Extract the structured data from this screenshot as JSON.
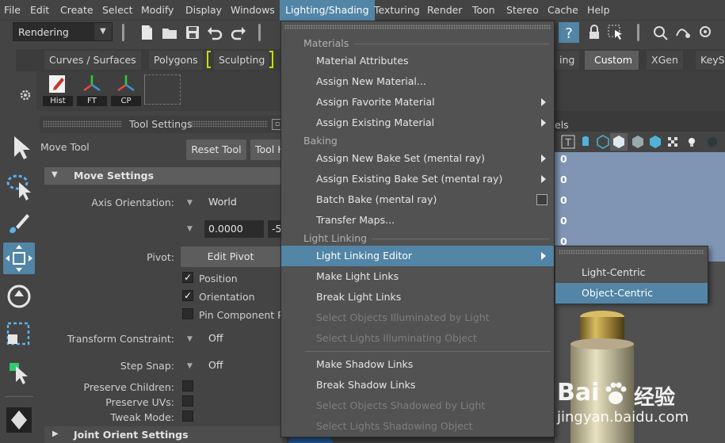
{
  "menubar": {
    "items": [
      "File",
      "Edit",
      "Create",
      "Select",
      "Modify",
      "Display",
      "Windows",
      "Lighting/Shading",
      "Texturing",
      "Render",
      "Toon",
      "Stereo",
      "Cache",
      "Help"
    ],
    "active": "Lighting/Shading"
  },
  "status": {
    "mode_value": "Rendering"
  },
  "shelf": {
    "tabs": [
      "Curves / Surfaces",
      "Polygons",
      "Sculpting",
      "ing",
      "Custom",
      "XGen",
      "KeySh"
    ],
    "active_tab": "Custom",
    "buttons": [
      "Hist",
      "FT",
      "CP"
    ]
  },
  "tool_settings": {
    "header": "Tool Settings",
    "tool_name": "Move Tool",
    "reset_button": "Reset Tool",
    "help_button": "Tool H",
    "section_move": "Move Settings",
    "axis_orientation_label": "Axis Orientation:",
    "axis_orientation_value": "World",
    "num_field_1": "0.0000",
    "num_field_2": "-5",
    "pivot_label": "Pivot:",
    "edit_pivot_button": "Edit Pivot",
    "position_label": "Position",
    "orientation_label": "Orientation",
    "pin_component_label": "Pin Component Pi",
    "transform_constraint_label": "Transform Constraint:",
    "transform_constraint_value": "Off",
    "step_snap_label": "Step Snap:",
    "step_snap_value": "Off",
    "preserve_children_label": "Preserve Children:",
    "preserve_uvs_label": "Preserve UVs:",
    "tweak_mode_label": "Tweak Mode:",
    "section_joint": "Joint Orient Settings"
  },
  "channel_box": {
    "header_partial": "els",
    "values": [
      "0",
      "0",
      "0",
      "0",
      "0"
    ]
  },
  "menu": {
    "sections": {
      "materials": "Materials",
      "baking": "Baking",
      "light_linking": "Light Linking"
    },
    "items": {
      "material_attributes": "Material Attributes",
      "assign_new_material": "Assign New Material...",
      "assign_favorite_material": "Assign Favorite Material",
      "assign_existing_material": "Assign Existing Material",
      "assign_new_bake_set": "Assign New Bake Set (mental ray)",
      "assign_existing_bake_set": "Assign Existing Bake Set (mental ray)",
      "batch_bake": "Batch Bake (mental ray)",
      "transfer_maps": "Transfer Maps...",
      "light_linking_editor": "Light Linking Editor",
      "make_light_links": "Make Light Links",
      "break_light_links": "Break Light Links",
      "select_objects_illuminated": "Select Objects Illuminated by Light",
      "select_lights_illuminating": "Select Lights Illuminating Object",
      "make_shadow_links": "Make Shadow Links",
      "break_shadow_links": "Break Shadow Links",
      "select_objects_shadowed": "Select Objects Shadowed by Light",
      "select_lights_shadowing": "Select Lights Shadowing Object"
    }
  },
  "submenu": {
    "light_centric": "Light-Centric",
    "object_centric": "Object-Centric"
  },
  "watermark": {
    "brand": "Bai",
    "brand_cn": "经验",
    "url": "jingyan.baidu.com"
  },
  "colors": {
    "accent": "#5285a6",
    "panel": "#444444",
    "menu": "#525252",
    "channel_rows": "#7f95b3",
    "sculpt_bracket": "#c7e000"
  }
}
